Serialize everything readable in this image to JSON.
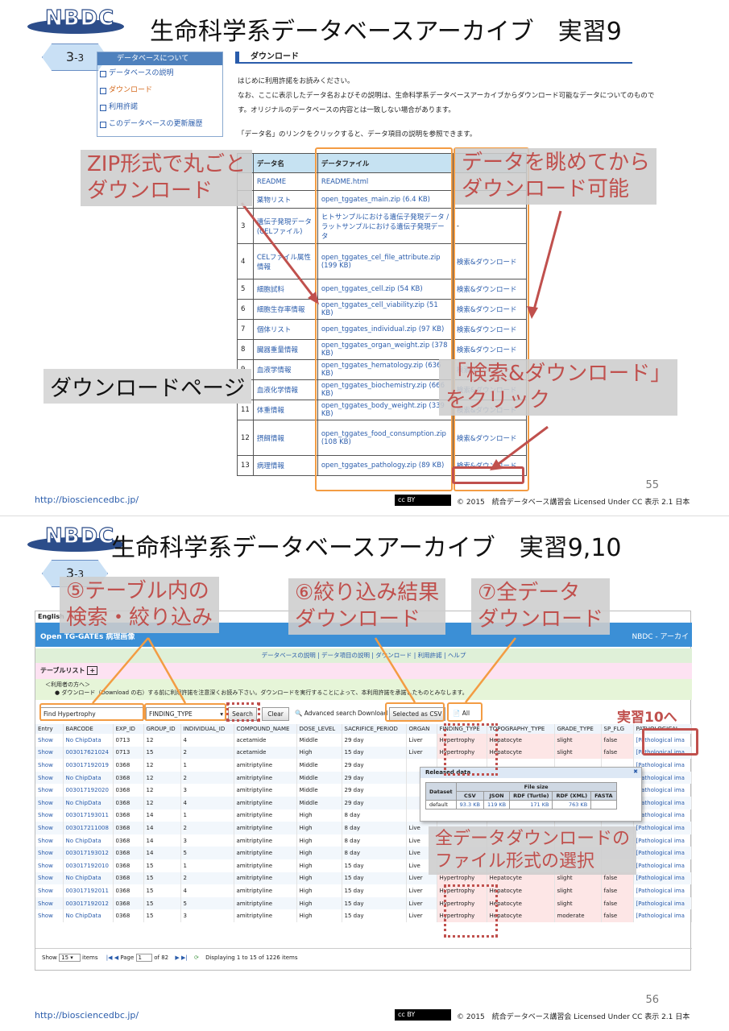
{
  "slide1": {
    "logo": "NBDC",
    "title": "生命科学系データベースアーカイブ　実習9",
    "section": "3",
    "section_sub": "-3",
    "nav": {
      "header": "データベースについて",
      "items": [
        "データベースの説明",
        "ダウンロード",
        "利用許諾",
        "このデータベースの更新履歴"
      ]
    },
    "download_header": "ダウンロード",
    "intro": [
      "はじめに利用許諾をお読みください。",
      "なお、ここに表示したデータ名およびその説明は、生命科学系データベースアーカイブからダウンロード可能なデータについてのもので",
      "す。オリジナルのデータベースの内容とは一致しない場合があります。",
      "「データ名」のリンクをクリックすると、データ項目の説明を参照できます。"
    ],
    "table": {
      "headers": [
        "",
        "データ名",
        "データファイル",
        ""
      ],
      "rows": [
        [
          "",
          "README",
          "README.html",
          ""
        ],
        [
          "",
          "薬物リスト",
          "open_tggates_main.zip (6.4 KB)",
          ""
        ],
        [
          "3",
          "遺伝子発現データ (CELファイル)",
          "ヒトサンプルにおける遺伝子発現データ / ラットサンプルにおける遺伝子発現データ",
          "-"
        ],
        [
          "4",
          "CELファイル属性情報",
          "open_tggates_cel_file_attribute.zip (199 KB)",
          "検索&ダウンロード"
        ],
        [
          "5",
          "細胞試料",
          "open_tggates_cell.zip (54 KB)",
          "検索&ダウンロード"
        ],
        [
          "6",
          "細胞生存率情報",
          "open_tggates_cell_viability.zip (51 KB)",
          "検索&ダウンロード"
        ],
        [
          "7",
          "個体リスト",
          "open_tggates_individual.zip (97 KB)",
          "検索&ダウンロード"
        ],
        [
          "8",
          "臓器重量情報",
          "open_tggates_organ_weight.zip (378 KB)",
          "検索&ダウンロード"
        ],
        [
          "9",
          "血液学情報",
          "open_tggates_hematology.zip (636 KB)",
          "検索&ダウンロード"
        ],
        [
          "10",
          "血液化学情報",
          "open_tggates_biochemistry.zip (666 KB)",
          "検索&ダウンロード"
        ],
        [
          "11",
          "体重情報",
          "open_tggates_body_weight.zip (339 KB)",
          "検索&ダウンロード"
        ],
        [
          "12",
          "摂餌情報",
          "open_tggates_food_consumption.zip (108 KB)",
          "検索&ダウンロード"
        ],
        [
          "13",
          "病理情報",
          "open_tggates_pathology.zip (89 KB)",
          "検索&ダウンロード"
        ]
      ]
    },
    "callouts": {
      "zip": "ZIP形式で丸ごと\nダウンロード",
      "view": "データを眺めてから\nダウンロード可能",
      "page": "ダウンロードページ",
      "click": "「検索&ダウンロード」\nをクリック"
    },
    "footer_url": "http://biosciencedbc.jp/",
    "cc": "cc BY",
    "copyright": "© 2015　統合データベース講習会 Licensed Under CC 表示 2.1 日本",
    "page": "55"
  },
  "slide2": {
    "logo": "NBDC",
    "title": "生命科学系データベースアーカイブ　実習9,10",
    "section": "3",
    "section_sub": "-3",
    "callouts": {
      "search": "⑤テーブル内の\n検索・絞り込み",
      "filtered": "⑥絞り込み結果\nダウンロード",
      "all": "⑦全データ\nダウンロード",
      "format": "全データダウンロードの\nファイル形式の選択",
      "ex10": "実習10へ"
    },
    "app": {
      "lang": "English",
      "brand": "Open TG-GATEs 病理画像",
      "brand_right": "NBDC - アーカイ",
      "nav": "データベースの説明 | データ項目の説明 | ダウンロード | 利用許諾 | ヘルプ",
      "table_list": "テーブルリスト",
      "notice1": "＜利用者の方へ＞",
      "notice2": "● ダウンロード（Download の右）する前に利用許諾を注意深くお読み下さい。ダウンロードを実行することによって、本利用許諾を承諾したものとみなします。",
      "find_value": "Find  Hypertrophy",
      "field_select": "FINDING_TYPE",
      "search_btn": "Search",
      "clear_btn": "Clear",
      "adv": "Advanced search",
      "download_label": "Download",
      "csv_btn": "Selected as CSV",
      "all_btn": "All",
      "columns": [
        "Entry",
        "BARCODE",
        "EXP_ID",
        "GROUP_ID",
        "INDIVIDUAL_ID",
        "COMPOUND_NAME",
        "DOSE_LEVEL",
        "SACRIFICE_PERIOD",
        "ORGAN",
        "FINDING_TYPE",
        "TOPOGRAPHY_TYPE",
        "GRADE_TYPE",
        "SP_FLG",
        "PATHOLOGICAL"
      ],
      "rows": [
        [
          "Show",
          "No ChipData",
          "0713",
          "12",
          "4",
          "acetamide",
          "Middle",
          "29 day",
          "Liver",
          "Hypertrophy",
          "Hepatocyte",
          "slight",
          "false",
          "[Pathological ima"
        ],
        [
          "Show",
          "003017621024",
          "0713",
          "15",
          "2",
          "acetamide",
          "High",
          "15 day",
          "Liver",
          "Hypertrophy",
          "Hepatocyte",
          "slight",
          "false",
          "[Pathological ima"
        ],
        [
          "Show",
          "003017192019",
          "0368",
          "12",
          "1",
          "amitriptyline",
          "Middle",
          "29 day",
          "",
          "",
          "",
          "",
          "",
          "[Pathological ima"
        ],
        [
          "Show",
          "No ChipData",
          "0368",
          "12",
          "2",
          "amitriptyline",
          "Middle",
          "29 day",
          "",
          "",
          "",
          "",
          "",
          "[Pathological ima"
        ],
        [
          "Show",
          "003017192020",
          "0368",
          "12",
          "3",
          "amitriptyline",
          "Middle",
          "29 day",
          "",
          "",
          "",
          "",
          "",
          "[Pathological ima"
        ],
        [
          "Show",
          "No ChipData",
          "0368",
          "12",
          "4",
          "amitriptyline",
          "Middle",
          "29 day",
          "",
          "",
          "",
          "",
          "",
          "[Pathological ima"
        ],
        [
          "Show",
          "003017193011",
          "0368",
          "14",
          "1",
          "amitriptyline",
          "High",
          "8 day",
          "",
          "",
          "",
          "",
          "",
          "[Pathological ima"
        ],
        [
          "Show",
          "003017211008",
          "0368",
          "14",
          "2",
          "amitriptyline",
          "High",
          "8 day",
          "Live",
          "",
          "",
          "",
          "",
          "[Pathological ima"
        ],
        [
          "Show",
          "No ChipData",
          "0368",
          "14",
          "3",
          "amitriptyline",
          "High",
          "8 day",
          "Live",
          "",
          "",
          "",
          "",
          "[Pathological ima"
        ],
        [
          "Show",
          "003017193012",
          "0368",
          "14",
          "5",
          "amitriptyline",
          "High",
          "8 day",
          "Live",
          "",
          "",
          "",
          "",
          "[Pathological ima"
        ],
        [
          "Show",
          "003017192010",
          "0368",
          "15",
          "1",
          "amitriptyline",
          "High",
          "15 day",
          "Live",
          "",
          "",
          "",
          "",
          "[Pathological ima"
        ],
        [
          "Show",
          "No ChipData",
          "0368",
          "15",
          "2",
          "amitriptyline",
          "High",
          "15 day",
          "Liver",
          "Hypertrophy",
          "Hepatocyte",
          "slight",
          "false",
          "[Pathological ima"
        ],
        [
          "Show",
          "003017192011",
          "0368",
          "15",
          "4",
          "amitriptyline",
          "High",
          "15 day",
          "Liver",
          "Hypertrophy",
          "Hepatocyte",
          "slight",
          "false",
          "[Pathological ima"
        ],
        [
          "Show",
          "003017192012",
          "0368",
          "15",
          "5",
          "amitriptyline",
          "High",
          "15 day",
          "Liver",
          "Hypertrophy",
          "Hepatocyte",
          "slight",
          "false",
          "[Pathological ima"
        ],
        [
          "Show",
          "No ChipData",
          "0368",
          "15",
          "3",
          "amitriptyline",
          "High",
          "15 day",
          "Liver",
          "Hypertrophy",
          "Hepatocyte",
          "moderate",
          "false",
          "[Pathological ima"
        ]
      ],
      "pager": {
        "show": "Show",
        "per_page": "15",
        "items": "items",
        "page_label": "Page",
        "page": "1",
        "of": "of 82",
        "display": "Displaying 1 to 15 of 1226 items"
      },
      "popup": {
        "title": "Released data",
        "filesize": "File size",
        "headers": [
          "Dataset",
          "CSV",
          "JSON",
          "RDF (Turtle)",
          "RDF (XML)",
          "FASTA"
        ],
        "row": [
          "default",
          "93.3 KB",
          "119 KB",
          "171 KB",
          "763 KB",
          ""
        ]
      }
    },
    "footer_url": "http://biosciencedbc.jp/",
    "cc": "cc BY",
    "copyright": "© 2015　統合データベース講習会 Licensed Under CC 表示 2.1 日本",
    "page": "56"
  }
}
